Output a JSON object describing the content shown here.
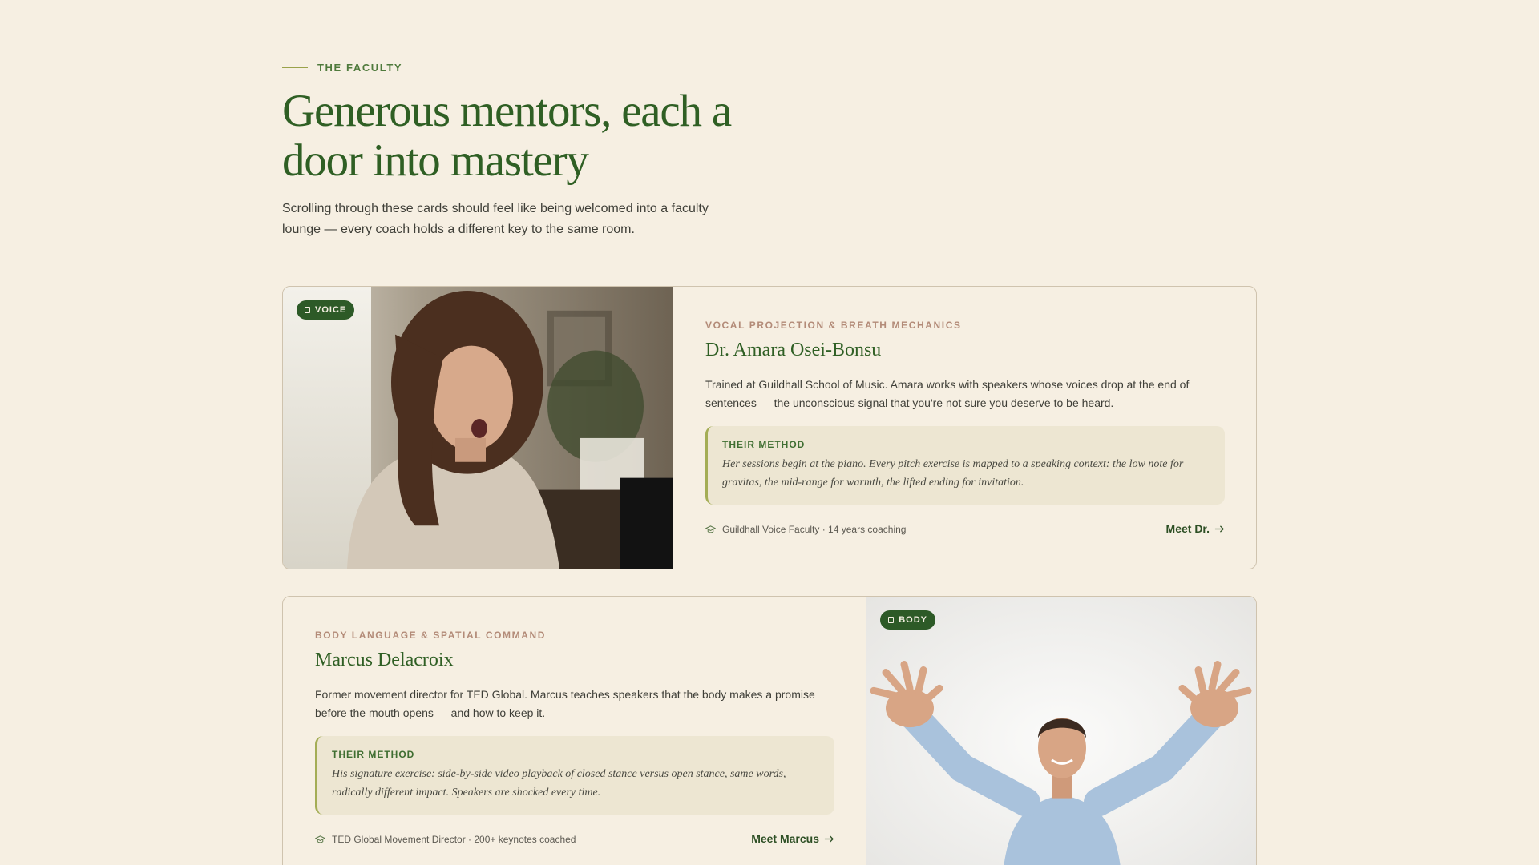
{
  "header": {
    "eyebrow": "THE FACULTY",
    "title": "Generous mentors, each a door into mastery",
    "subtitle": "Scrolling through these cards should feel like being welcomed into a faculty lounge — every coach holds a different key to the same room."
  },
  "faculty": [
    {
      "tag": "VOICE",
      "speciality": "VOCAL PROJECTION & BREATH MECHANICS",
      "name": "Dr. Amara Osei-Bonsu",
      "bio": "Trained at Guildhall School of Music. Amara works with speakers whose voices drop at the end of sentences — the unconscious signal that you're not sure you deserve to be heard.",
      "method_label": "THEIR METHOD",
      "method_text": "Her sessions begin at the piano. Every pitch exercise is mapped to a speaking context: the low note for gravitas, the mid-range for warmth, the lifted ending for invitation.",
      "meta": "Guildhall Voice Faculty · 14 years coaching",
      "cta": "Meet Dr."
    },
    {
      "tag": "BODY",
      "speciality": "BODY LANGUAGE & SPATIAL COMMAND",
      "name": "Marcus Delacroix",
      "bio": "Former movement director for TED Global. Marcus teaches speakers that the body makes a promise before the mouth opens — and how to keep it.",
      "method_label": "THEIR METHOD",
      "method_text": "His signature exercise: side-by-side video playback of closed stance versus open stance, same words, radically different impact. Speakers are shocked every time.",
      "meta": "TED Global Movement Director · 200+ keynotes coached",
      "cta": "Meet Marcus"
    }
  ],
  "colors": {
    "background": "#f6efe2",
    "accent_green": "#2d5a27",
    "speciality_rose": "#b38b78",
    "method_bg": "#ede6d2",
    "method_border": "#a4ad55"
  },
  "icons": {
    "tag": "tag-icon",
    "meta": "graduation-cap-icon",
    "cta": "arrow-right-icon"
  }
}
